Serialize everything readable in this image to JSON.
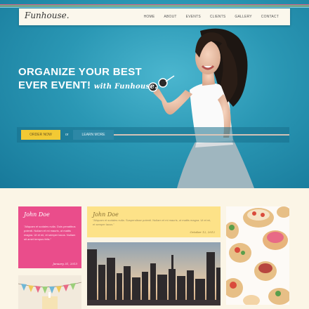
{
  "brand": {
    "logo": "Funhouse."
  },
  "nav": {
    "items": [
      "HOME",
      "ABOUT",
      "EVENTS",
      "CLIENTS",
      "GALLERY",
      "CONTACT"
    ]
  },
  "hero": {
    "headline_line1": "ORGANIZE YOUR BEST",
    "headline_line2": "EVER EVENT!",
    "headline_script": "with Funhouse.",
    "order_button": "ORDER NOW",
    "or_text": "or",
    "learn_button": "LEARN MORE"
  },
  "testimonials": [
    {
      "name": "John Doe",
      "text": "\"Aliquam et sodales nulla. Duis penatibus potenti. Nullam et mi mauris, ut mattis magna. Ut et mi, et semper lacus. Nullam sit amet tempus felis.\"",
      "sign": "January 31, 2013"
    },
    {
      "name": "John Doe",
      "text": "\"Aliquam et sodales nulla. Suspendisse potenti. Nullam et mi mauris, ut mattis magna. Ut et mi, et semper lacus.\"",
      "sign": "October 12, 2012"
    }
  ],
  "colors": {
    "hero_bg": "#2a97b4",
    "nav_bg": "#fbf7ec",
    "pink_card": "#ea4d8b",
    "yellow_card": "#fde288",
    "order_button": "#f2c934",
    "learn_button": "#2d88a6",
    "page_bg": "#fbf5e6"
  }
}
